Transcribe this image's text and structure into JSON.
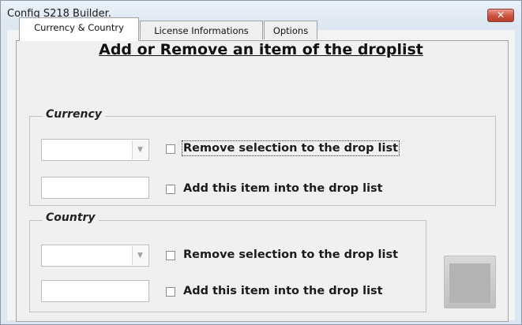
{
  "window": {
    "title": "Config S218 Builder.",
    "close_label": "✕"
  },
  "tabs": [
    "Currency & Country",
    "License Informations",
    "Options"
  ],
  "page": {
    "heading": "Add or Remove an item of the droplist"
  },
  "currency": {
    "frame_title": "Currency",
    "combo_value": "",
    "combo_arrow": "▼",
    "text_value": "",
    "remove_label": "Remove selection to the drop list",
    "add_label": "Add this item into the drop list"
  },
  "country": {
    "frame_title": "Country",
    "combo_value": "",
    "combo_arrow": "▼",
    "text_value": "",
    "remove_label": "Remove selection to the drop list",
    "add_label": "Add this item into the drop list"
  }
}
